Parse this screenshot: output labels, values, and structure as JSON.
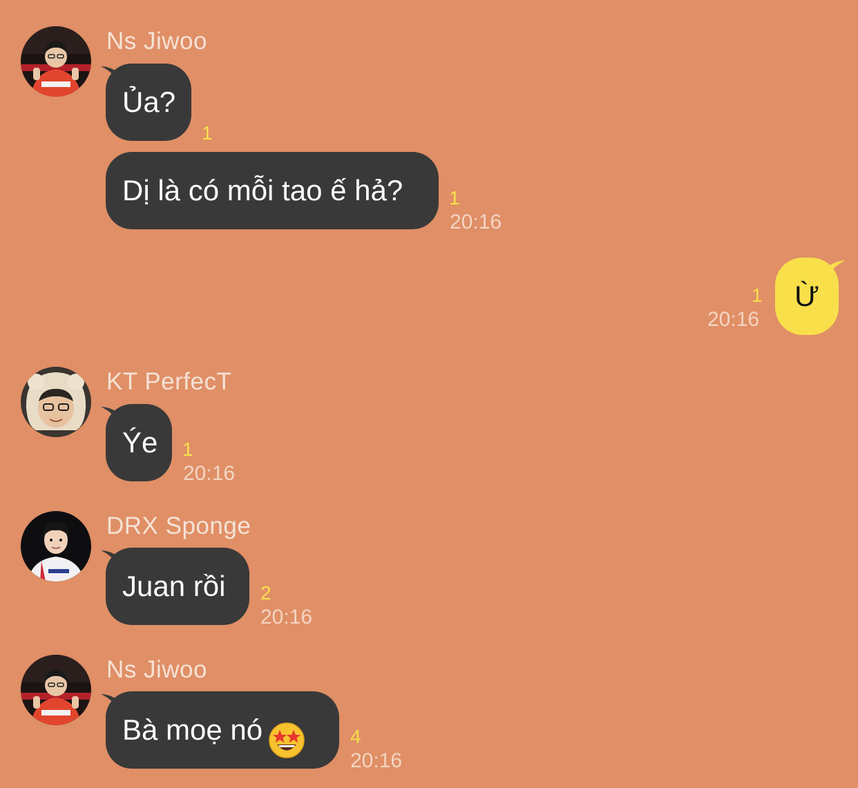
{
  "colors": {
    "background": "#E08F66",
    "incoming_bubble": "#393939",
    "outgoing_bubble": "#F9E04B",
    "unread_count": "#F9E04B"
  },
  "messages": [
    {
      "sender": "Ns Jiwoo",
      "avatar": "jiwoo-avatar",
      "bubbles": [
        {
          "text": "Ủa?",
          "unread": "1",
          "time": ""
        },
        {
          "text": "Dị là có mỗi tao ế hả?",
          "unread": "1",
          "time": "20:16"
        }
      ]
    },
    {
      "sender": "me",
      "bubbles": [
        {
          "text": "Ừ",
          "unread": "1",
          "time": "20:16"
        }
      ]
    },
    {
      "sender": "KT PerfecT",
      "avatar": "perfect-avatar",
      "bubbles": [
        {
          "text": "Ýe",
          "unread": "1",
          "time": "20:16"
        }
      ]
    },
    {
      "sender": "DRX Sponge",
      "avatar": "sponge-avatar",
      "bubbles": [
        {
          "text": "Juan rồi",
          "unread": "2",
          "time": "20:16"
        }
      ]
    },
    {
      "sender": "Ns Jiwoo",
      "avatar": "jiwoo-avatar",
      "bubbles": [
        {
          "text": "Bà moẹ nó",
          "emoji": "star-struck-emoji",
          "unread": "4",
          "time": "20:16"
        }
      ]
    }
  ]
}
